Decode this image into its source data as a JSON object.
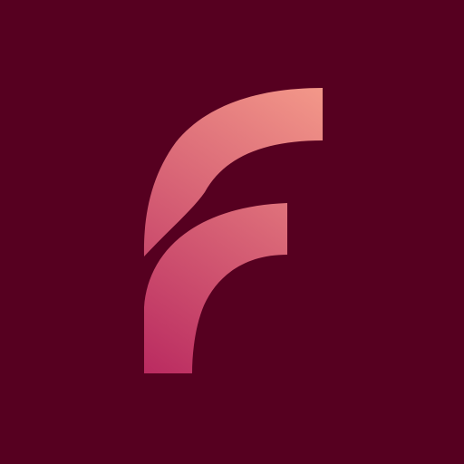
{
  "app_icon": {
    "icon": "stylized-letter-f-logo",
    "colors": {
      "background": "#560020",
      "gradient_start": "#B8275F",
      "gradient_end": "#F49A8A"
    }
  }
}
